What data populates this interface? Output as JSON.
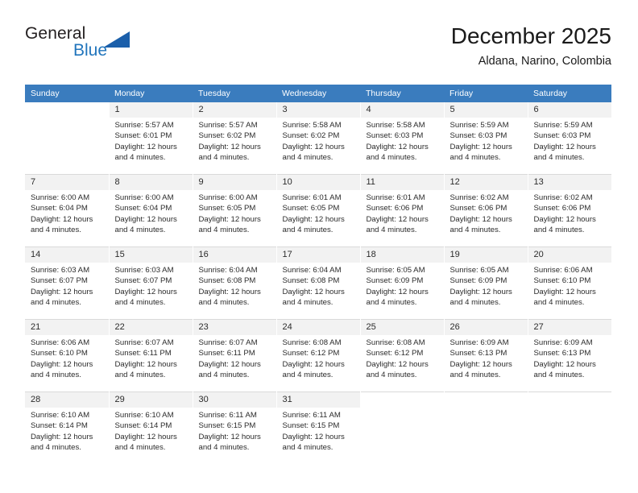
{
  "brand": {
    "name_part1": "General",
    "name_part2": "Blue",
    "logo_icon": "triangle-logo-icon",
    "accent_color": "#2175bc",
    "triangle_color": "#1b5faa"
  },
  "header": {
    "title": "December 2025",
    "location": "Aldana, Narino, Colombia"
  },
  "calendar": {
    "header_background": "#3a7cbe",
    "daynum_background": "#f2f2f2",
    "weekday_names": [
      "Sunday",
      "Monday",
      "Tuesday",
      "Wednesday",
      "Thursday",
      "Friday",
      "Saturday"
    ],
    "weeks": [
      [
        {
          "day": "",
          "sunrise": "",
          "sunset": "",
          "daylight_line1": "",
          "daylight_line2": ""
        },
        {
          "day": "1",
          "sunrise": "Sunrise: 5:57 AM",
          "sunset": "Sunset: 6:01 PM",
          "daylight_line1": "Daylight: 12 hours",
          "daylight_line2": "and 4 minutes."
        },
        {
          "day": "2",
          "sunrise": "Sunrise: 5:57 AM",
          "sunset": "Sunset: 6:02 PM",
          "daylight_line1": "Daylight: 12 hours",
          "daylight_line2": "and 4 minutes."
        },
        {
          "day": "3",
          "sunrise": "Sunrise: 5:58 AM",
          "sunset": "Sunset: 6:02 PM",
          "daylight_line1": "Daylight: 12 hours",
          "daylight_line2": "and 4 minutes."
        },
        {
          "day": "4",
          "sunrise": "Sunrise: 5:58 AM",
          "sunset": "Sunset: 6:03 PM",
          "daylight_line1": "Daylight: 12 hours",
          "daylight_line2": "and 4 minutes."
        },
        {
          "day": "5",
          "sunrise": "Sunrise: 5:59 AM",
          "sunset": "Sunset: 6:03 PM",
          "daylight_line1": "Daylight: 12 hours",
          "daylight_line2": "and 4 minutes."
        },
        {
          "day": "6",
          "sunrise": "Sunrise: 5:59 AM",
          "sunset": "Sunset: 6:03 PM",
          "daylight_line1": "Daylight: 12 hours",
          "daylight_line2": "and 4 minutes."
        }
      ],
      [
        {
          "day": "7",
          "sunrise": "Sunrise: 6:00 AM",
          "sunset": "Sunset: 6:04 PM",
          "daylight_line1": "Daylight: 12 hours",
          "daylight_line2": "and 4 minutes."
        },
        {
          "day": "8",
          "sunrise": "Sunrise: 6:00 AM",
          "sunset": "Sunset: 6:04 PM",
          "daylight_line1": "Daylight: 12 hours",
          "daylight_line2": "and 4 minutes."
        },
        {
          "day": "9",
          "sunrise": "Sunrise: 6:00 AM",
          "sunset": "Sunset: 6:05 PM",
          "daylight_line1": "Daylight: 12 hours",
          "daylight_line2": "and 4 minutes."
        },
        {
          "day": "10",
          "sunrise": "Sunrise: 6:01 AM",
          "sunset": "Sunset: 6:05 PM",
          "daylight_line1": "Daylight: 12 hours",
          "daylight_line2": "and 4 minutes."
        },
        {
          "day": "11",
          "sunrise": "Sunrise: 6:01 AM",
          "sunset": "Sunset: 6:06 PM",
          "daylight_line1": "Daylight: 12 hours",
          "daylight_line2": "and 4 minutes."
        },
        {
          "day": "12",
          "sunrise": "Sunrise: 6:02 AM",
          "sunset": "Sunset: 6:06 PM",
          "daylight_line1": "Daylight: 12 hours",
          "daylight_line2": "and 4 minutes."
        },
        {
          "day": "13",
          "sunrise": "Sunrise: 6:02 AM",
          "sunset": "Sunset: 6:06 PM",
          "daylight_line1": "Daylight: 12 hours",
          "daylight_line2": "and 4 minutes."
        }
      ],
      [
        {
          "day": "14",
          "sunrise": "Sunrise: 6:03 AM",
          "sunset": "Sunset: 6:07 PM",
          "daylight_line1": "Daylight: 12 hours",
          "daylight_line2": "and 4 minutes."
        },
        {
          "day": "15",
          "sunrise": "Sunrise: 6:03 AM",
          "sunset": "Sunset: 6:07 PM",
          "daylight_line1": "Daylight: 12 hours",
          "daylight_line2": "and 4 minutes."
        },
        {
          "day": "16",
          "sunrise": "Sunrise: 6:04 AM",
          "sunset": "Sunset: 6:08 PM",
          "daylight_line1": "Daylight: 12 hours",
          "daylight_line2": "and 4 minutes."
        },
        {
          "day": "17",
          "sunrise": "Sunrise: 6:04 AM",
          "sunset": "Sunset: 6:08 PM",
          "daylight_line1": "Daylight: 12 hours",
          "daylight_line2": "and 4 minutes."
        },
        {
          "day": "18",
          "sunrise": "Sunrise: 6:05 AM",
          "sunset": "Sunset: 6:09 PM",
          "daylight_line1": "Daylight: 12 hours",
          "daylight_line2": "and 4 minutes."
        },
        {
          "day": "19",
          "sunrise": "Sunrise: 6:05 AM",
          "sunset": "Sunset: 6:09 PM",
          "daylight_line1": "Daylight: 12 hours",
          "daylight_line2": "and 4 minutes."
        },
        {
          "day": "20",
          "sunrise": "Sunrise: 6:06 AM",
          "sunset": "Sunset: 6:10 PM",
          "daylight_line1": "Daylight: 12 hours",
          "daylight_line2": "and 4 minutes."
        }
      ],
      [
        {
          "day": "21",
          "sunrise": "Sunrise: 6:06 AM",
          "sunset": "Sunset: 6:10 PM",
          "daylight_line1": "Daylight: 12 hours",
          "daylight_line2": "and 4 minutes."
        },
        {
          "day": "22",
          "sunrise": "Sunrise: 6:07 AM",
          "sunset": "Sunset: 6:11 PM",
          "daylight_line1": "Daylight: 12 hours",
          "daylight_line2": "and 4 minutes."
        },
        {
          "day": "23",
          "sunrise": "Sunrise: 6:07 AM",
          "sunset": "Sunset: 6:11 PM",
          "daylight_line1": "Daylight: 12 hours",
          "daylight_line2": "and 4 minutes."
        },
        {
          "day": "24",
          "sunrise": "Sunrise: 6:08 AM",
          "sunset": "Sunset: 6:12 PM",
          "daylight_line1": "Daylight: 12 hours",
          "daylight_line2": "and 4 minutes."
        },
        {
          "day": "25",
          "sunrise": "Sunrise: 6:08 AM",
          "sunset": "Sunset: 6:12 PM",
          "daylight_line1": "Daylight: 12 hours",
          "daylight_line2": "and 4 minutes."
        },
        {
          "day": "26",
          "sunrise": "Sunrise: 6:09 AM",
          "sunset": "Sunset: 6:13 PM",
          "daylight_line1": "Daylight: 12 hours",
          "daylight_line2": "and 4 minutes."
        },
        {
          "day": "27",
          "sunrise": "Sunrise: 6:09 AM",
          "sunset": "Sunset: 6:13 PM",
          "daylight_line1": "Daylight: 12 hours",
          "daylight_line2": "and 4 minutes."
        }
      ],
      [
        {
          "day": "28",
          "sunrise": "Sunrise: 6:10 AM",
          "sunset": "Sunset: 6:14 PM",
          "daylight_line1": "Daylight: 12 hours",
          "daylight_line2": "and 4 minutes."
        },
        {
          "day": "29",
          "sunrise": "Sunrise: 6:10 AM",
          "sunset": "Sunset: 6:14 PM",
          "daylight_line1": "Daylight: 12 hours",
          "daylight_line2": "and 4 minutes."
        },
        {
          "day": "30",
          "sunrise": "Sunrise: 6:11 AM",
          "sunset": "Sunset: 6:15 PM",
          "daylight_line1": "Daylight: 12 hours",
          "daylight_line2": "and 4 minutes."
        },
        {
          "day": "31",
          "sunrise": "Sunrise: 6:11 AM",
          "sunset": "Sunset: 6:15 PM",
          "daylight_line1": "Daylight: 12 hours",
          "daylight_line2": "and 4 minutes."
        },
        {
          "day": "",
          "sunrise": "",
          "sunset": "",
          "daylight_line1": "",
          "daylight_line2": ""
        },
        {
          "day": "",
          "sunrise": "",
          "sunset": "",
          "daylight_line1": "",
          "daylight_line2": ""
        },
        {
          "day": "",
          "sunrise": "",
          "sunset": "",
          "daylight_line1": "",
          "daylight_line2": ""
        }
      ]
    ]
  }
}
